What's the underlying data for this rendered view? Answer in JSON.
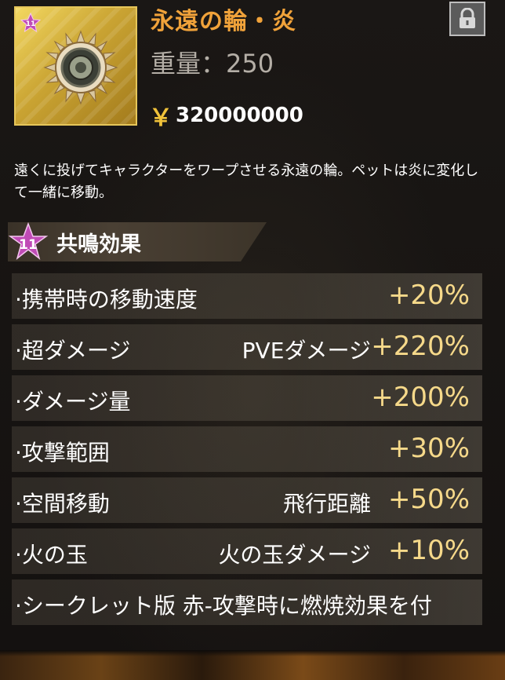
{
  "item": {
    "name": "永遠の輪・炎",
    "weight_label": "重量：250",
    "price_symbol": "￥",
    "price": "320000000",
    "grade": "11",
    "art_icon": "spiked-ring-icon",
    "lock_icon": "padlock-icon"
  },
  "description": "遠くに投げてキャラクターをワープさせる永遠の輪。ペットは炎に変化して一緒に移動。",
  "resonance": {
    "grade": "11",
    "title": "共鳴効果"
  },
  "effects": [
    {
      "name": "·携帯時の移動速度",
      "sub": "",
      "value": "+20%"
    },
    {
      "name": "·超ダメージ",
      "sub": "PVEダメージ",
      "value": "+220%"
    },
    {
      "name": "·ダメージ量",
      "sub": "",
      "value": "+200%"
    },
    {
      "name": "·攻撃範囲",
      "sub": "",
      "value": "+30%"
    },
    {
      "name": "·空間移動",
      "sub": "飛行距離",
      "value": "+50%"
    },
    {
      "name": "·火の玉",
      "sub": "火の玉ダメージ",
      "value": "+10%"
    },
    {
      "name": "·シークレット版 赤-攻撃時に燃焼効果を付",
      "sub": "",
      "value": ""
    }
  ],
  "colors": {
    "item_name": "#f0a23a",
    "value": "#f6d98a",
    "frame_gold": "#e6c65a",
    "badge_pink": "#c04bb6"
  }
}
